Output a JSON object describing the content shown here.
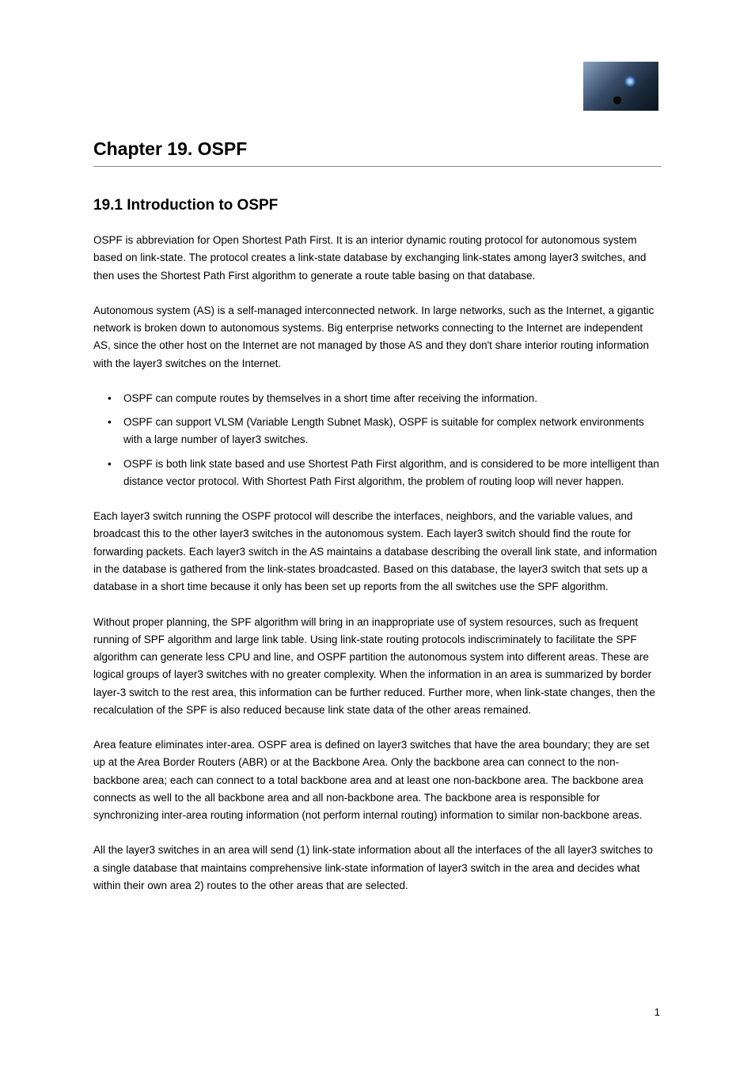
{
  "logo": {
    "name": "wolf-eye-logo"
  },
  "chapter": {
    "title": "Chapter 19. OSPF"
  },
  "section": {
    "heading": "19.1 Introduction to OSPF",
    "paragraph": "OSPF is abbreviation for Open Shortest Path First. It is an interior dynamic routing protocol for autonomous system based on link-state. The protocol creates a link-state database by exchanging link-states among layer3 switches, and then uses the Shortest Path First algorithm to generate a route table basing on that database.",
    "intro_text": "Autonomous system (AS) is a self-managed interconnected network. In large networks, such as the Internet, a gigantic network is broken down to autonomous systems. Big enterprise networks connecting to the Internet are independent AS, since the other host on the Internet are not managed by those AS and they don't share interior routing information with the layer3 switches on the Internet."
  },
  "bullets": [
    "OSPF can compute routes by themselves in a short time after receiving the information.",
    "OSPF can support VLSM (Variable Length Subnet Mask), OSPF is suitable for complex network environments with a large number of layer3 switches.",
    "OSPF is both link state based and use Shortest Path First algorithm, and is considered to be more intelligent than distance vector protocol. With Shortest Path First algorithm, the problem of routing loop will never happen."
  ],
  "additional_paragraphs": [
    "Each layer3 switch running the OSPF protocol will describe the interfaces, neighbors, and the variable values, and broadcast this to the other layer3 switches in the autonomous system. Each layer3 switch should find the route for forwarding packets. Each layer3 switch in the AS maintains a database describing the overall link state, and information in the database is gathered from the link-states broadcasted. Based on this database, the layer3 switch that sets up a database in a short time because it only has been set up reports from the all switches use the SPF algorithm.",
    "Without proper planning, the SPF algorithm will bring in an inappropriate use of system resources, such as frequent running of SPF algorithm and large link table. Using link-state routing protocols indiscriminately to facilitate the SPF algorithm can generate less CPU and line, and OSPF partition the autonomous system into different areas. These are logical groups of layer3 switches with no greater complexity. When the information in an area is summarized by border layer-3 switch to the rest area, this information can be further reduced. Further more, when link-state changes, then the recalculation of the SPF is also reduced because link state data of the other areas remained.",
    "Area feature eliminates inter-area. OSPF area is defined on layer3 switches that have the area boundary; they are set up at the Area Border Routers (ABR) or at the Backbone Area. Only the backbone area can connect to the non-backbone area; each can connect to a total backbone area and at least one non-backbone area. The backbone area connects as well to the all backbone area and all non-backbone area. The backbone area is responsible for synchronizing inter-area routing information (not perform internal routing) information to similar non-backbone areas.",
    "All the layer3 switches in an area will send (1) link-state information about all the interfaces of the all layer3 switches to a single database that maintains comprehensive link-state information of layer3 switch in the area and decides what within their own area 2) routes to the other areas that are selected."
  ],
  "page_number": "1"
}
